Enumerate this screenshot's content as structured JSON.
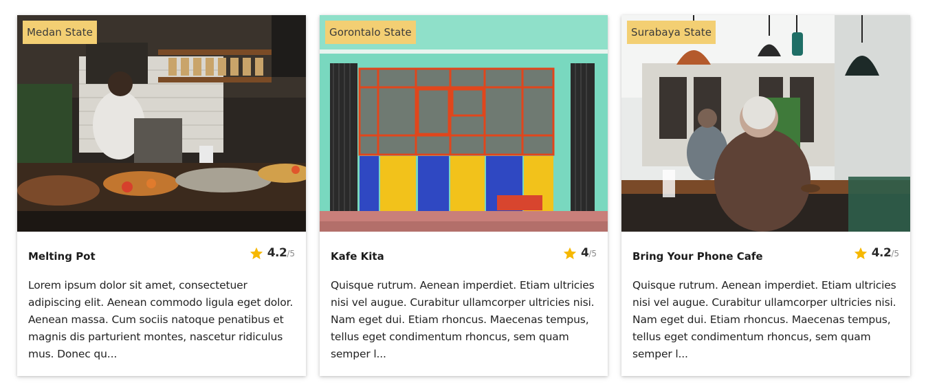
{
  "cards": [
    {
      "location": "Medan State",
      "name": "Melting Pot",
      "rating": "4.2",
      "rating_max": "/5",
      "description": "Lorem ipsum dolor sit amet, consectetuer adipiscing elit. Aenean commodo ligula eget dolor. Aenean massa. Cum sociis natoque penatibus et magnis dis parturient montes, nascetur ridiculus mus. Donec qu..."
    },
    {
      "location": "Gorontalo State",
      "name": "Kafe Kita",
      "rating": "4",
      "rating_max": "/5",
      "description": "Quisque rutrum. Aenean imperdiet. Etiam ultricies nisi vel augue. Curabitur ullamcorper ultricies nisi. Nam eget dui. Etiam rhoncus. Maecenas tempus, tellus eget condimentum rhoncus, sem quam semper l..."
    },
    {
      "location": "Surabaya State",
      "name": "Bring Your Phone Cafe",
      "rating": "4.2",
      "rating_max": "/5",
      "description": "Quisque rutrum. Aenean imperdiet. Etiam ultricies nisi vel augue. Curabitur ullamcorper ultricies nisi. Nam eget dui. Etiam rhoncus. Maecenas tempus, tellus eget condimentum rhoncus, sem quam semper l..."
    }
  ],
  "colors": {
    "badge_bg": "#f3cf73",
    "star": "#f6b800"
  },
  "icons": {
    "rating": "star-icon"
  }
}
